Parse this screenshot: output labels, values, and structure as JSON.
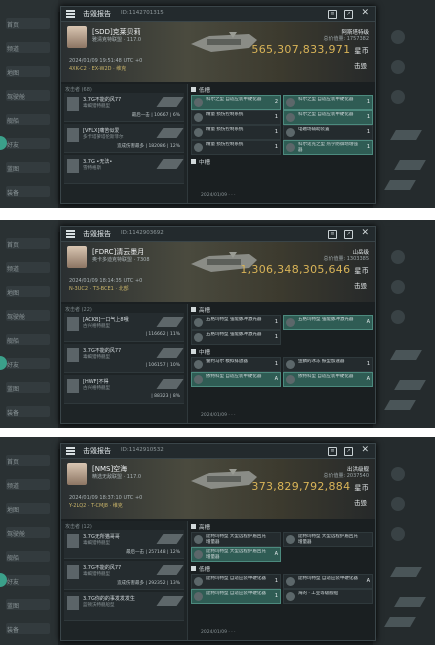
{
  "screenshots": [
    {
      "background": {
        "top_left": "30",
        "left_items": [
          "首页",
          "频道",
          "地图",
          "驾驶舱",
          "舰船",
          "好友",
          "蓝图",
          "装备"
        ]
      },
      "panel": {
        "title": "击毁报告",
        "id": "ID:1142701315",
        "victim": {
          "name": "[SDD]克莱贝莉",
          "corp": "雅清克特联盟 · 117.0",
          "time": "2024/01/09 19:51:48 UTC +0",
          "location": "4XK-C2 · EX-W2D · 维克"
        },
        "ship": {
          "name": "阿斯塔特级",
          "sub": "多弗泽密级"
        },
        "total_label": "总价值量: 1757382",
        "isk": "565,307,833,971",
        "isk_unit": "星币",
        "status": "击毁",
        "attackers_label": "攻击者 (68)",
        "attackers": [
          {
            "name": "3.7G不能的风77",
            "corp": "毒蝎猎特舰型",
            "dmg": "最后一击 | 10667 | 6%"
          },
          {
            "name": "[VFLX]痛苦似爱",
            "corp": "多卡塔萝塔伦斯菲尔",
            "dmg": "造成伤害最多 | 182086 | 12%"
          },
          {
            "name": "3.7G •无法•",
            "corp": "雪特格斯",
            "dmg": ""
          }
        ],
        "sections": [
          {
            "label": "低槽",
            "items": [
              {
                "name": "科尔之型 自适应装甲硬化器",
                "mark": "2",
                "hl": true
              },
              {
                "name": "科尔之型 自适应装甲硬化器",
                "mark": "1",
                "hl": true
              },
              {
                "name": "精量 损伤控制系统",
                "mark": "1",
                "hl": false
              },
              {
                "name": "科尔之型 自适应装甲硬化器",
                "mark": "1",
                "hl": true
              },
              {
                "name": "精量 损伤控制系统",
                "mark": "1",
                "hl": false
              },
              {
                "name": "电磁场辅助装置",
                "mark": "1",
                "hl": false
              },
              {
                "name": "精量 损伤控制系统",
                "mark": "1",
                "hl": false
              },
              {
                "name": "科尔诺克之型 热学防御场增强器",
                "mark": "1",
                "hl": true
              }
            ]
          },
          {
            "label": "中槽",
            "items": []
          }
        ],
        "footer": "2024/01/09 · · ·"
      }
    },
    {
      "background": {
        "top_left": "30",
        "left_items": [
          "首页",
          "频道",
          "地图",
          "驾驶舱",
          "舰船",
          "好友",
          "蓝图",
          "装备"
        ]
      },
      "panel": {
        "title": "击毁报告",
        "id": "ID:1142903692",
        "victim": {
          "name": "[FDRC]清云墨月",
          "corp": "奥卡多迪克特联盟 · 7308",
          "time": "2024/01/09 18:14:35 UTC +0",
          "location": "N-3UC2 · T3-BCE1 · 北部"
        },
        "ship": {
          "name": "山岳级",
          "sub": "航母级舰"
        },
        "total_label": "总价值量: 1303385",
        "isk": "1,306,348,305,646",
        "isk_unit": "星币",
        "status": "击毁",
        "attackers_label": "攻击者 (22)",
        "attackers": [
          {
            "name": "[ACKB]一口气上8哦",
            "corp": "古兴格特舰型",
            "dmg": "| 116662 | 11%"
          },
          {
            "name": "3.7G不能的风77",
            "corp": "毒蝎猎特舰型",
            "dmg": "| 106157 | 10%"
          },
          {
            "name": "[HWF]不得",
            "corp": "古兴格特舰型",
            "dmg": "| 88323 | 8%"
          }
        ],
        "sections": [
          {
            "label": "高槽",
            "items": [
              {
                "name": "五格玛特型 强能脉冲激光器",
                "mark": "1",
                "hl": false
              },
              {
                "name": "五格玛特型 强能脉冲激光器",
                "mark": "A",
                "hl": true
              },
              {
                "name": "五格玛特型 强能脉冲激光器",
                "mark": "1",
                "hl": false
              }
            ]
          },
          {
            "label": "中槽",
            "items": [
              {
                "name": "誓约马尔 模拟排放器",
                "mark": "1",
                "hl": false
              },
              {
                "name": "鱼鳞的冰冻 振型加速器",
                "mark": "1",
                "hl": false
              },
              {
                "name": "依特科型 自适应装甲硬化器",
                "mark": "A",
                "hl": true
              },
              {
                "name": "依特科型 自适应装甲硬化器",
                "mark": "A",
                "hl": true
              }
            ]
          }
        ],
        "footer": "2024/01/09 · · ·"
      }
    },
    {
      "background": {
        "top_left": "29",
        "left_items": [
          "首页",
          "频道",
          "地图",
          "驾驶舱",
          "舰船",
          "好友",
          "蓝图",
          "装备"
        ]
      },
      "panel": {
        "title": "击毁报告",
        "id": "ID:1142910532",
        "victim": {
          "name": "[NMS]空海",
          "corp": "精选无敌联盟 · 117.0",
          "time": "2024/01/09 18:37:10 UTC +0",
          "location": "Y-2LQ2 · T-CMJ8 · 维克"
        },
        "ship": {
          "name": "出洪级舰",
          "sub": "旗舰船艇级"
        },
        "total_label": "总价值量: 2037540",
        "isk": "373,829,792,884",
        "isk_unit": "星币",
        "status": "击毁",
        "attackers_label": "攻击者 (12)",
        "attackers": [
          {
            "name": "3.7G无所猫哥哥",
            "corp": "毒蝎猎特舰型",
            "dmg": "最后一击 | 257148 | 12%"
          },
          {
            "name": "3.7G不能的风77",
            "corp": "毒蝎猎特舰型",
            "dmg": "造成伤害最多 | 292352 | 13%"
          },
          {
            "name": "3.7G你的的事发发发生",
            "corp": "蓝顿沃特舰船型",
            "dmg": ""
          }
        ],
        "sections": [
          {
            "label": "高槽",
            "items": [
              {
                "name": "庞特玛特型 大型远程护盾回充增量器",
                "mark": "",
                "hl": false
              },
              {
                "name": "庞特玛特型 大型远程护盾回充增量器",
                "mark": "",
                "hl": false
              },
              {
                "name": "庞特玛特型 大型远程护盾回充增量器",
                "mark": "A",
                "hl": true
              }
            ]
          },
          {
            "label": "低槽",
            "items": [
              {
                "name": "庞特玛特型 自适应装甲硬化器",
                "mark": "1",
                "hl": false
              },
              {
                "name": "庞特玛特型 自适应装甲硬化器",
                "mark": "A",
                "hl": false
              },
              {
                "name": "庞特玛特型 自适应装甲硬化器",
                "mark": "1",
                "hl": true
              },
              {
                "name": "海的 · 工业等级舰船",
                "mark": "",
                "hl": false
              }
            ]
          }
        ],
        "footer": "2024/01/09 · · ·"
      }
    }
  ]
}
